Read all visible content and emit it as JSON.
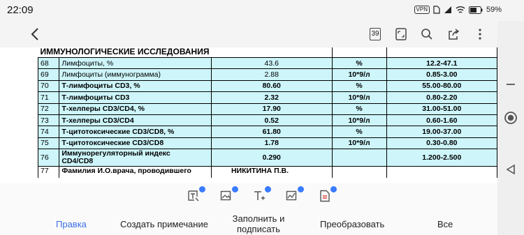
{
  "status_bar": {
    "time": "22:09",
    "vpn": "VPN",
    "battery": "59%"
  },
  "app_bar": {
    "page_count": "39"
  },
  "document": {
    "section_title": "ИММУНОЛОГИЧЕСКИЕ ИССЛЕДОВАНИЯ",
    "rows": [
      {
        "num": "68",
        "name": "Лимфоциты, %",
        "value": "43.6",
        "unit": "%",
        "ref": "12.2-47.1",
        "bold": false
      },
      {
        "num": "69",
        "name": "Лимфоциты (иммунограмма)",
        "value": "2.88",
        "unit": "10*9/л",
        "ref": "0.85-3.00",
        "bold": false
      },
      {
        "num": "70",
        "name": "Т-лимфоциты CD3, %",
        "value": "80.60",
        "unit": "%",
        "ref": "55.00-80.00",
        "bold": true
      },
      {
        "num": "71",
        "name": "Т-лимфоциты CD3",
        "value": "2.32",
        "unit": "10*9/л",
        "ref": "0.80-2.20",
        "bold": true
      },
      {
        "num": "72",
        "name": "Т-хелперы CD3/CD4, %",
        "value": "17.90",
        "unit": "%",
        "ref": "31.00-51.00",
        "bold": true
      },
      {
        "num": "73",
        "name": "Т-хелперы CD3/CD4",
        "value": "0.52",
        "unit": "10*9/л",
        "ref": "0.60-1.60",
        "bold": true
      },
      {
        "num": "74",
        "name": "Т-цитотоксические CD3/CD8, %",
        "value": "61.80",
        "unit": "%",
        "ref": "19.00-37.00",
        "bold": true
      },
      {
        "num": "75",
        "name": "Т-цитотоксические CD3/CD8",
        "value": "1.78",
        "unit": "10*9/л",
        "ref": "0.30-0.80",
        "bold": true
      }
    ],
    "row_76": {
      "num": "76",
      "name_line1": "Иммунорегуляторный индекс",
      "name_line2": "CD4/CD8",
      "value": "0.290",
      "unit": "",
      "ref": "1.200-2.500"
    },
    "row_77": {
      "num": "77",
      "name": "Фамилия И.О.врача, проводившего",
      "value": "НИКИТИНА П.В."
    }
  },
  "edit_toolbar": {
    "tools": [
      "text-note-icon",
      "image-edit-icon",
      "text-insert-icon",
      "signature-chart-icon",
      "pdf-convert-icon"
    ]
  },
  "bottom_nav": {
    "edit": "Правка",
    "comment": "Создать примечание",
    "fill_sign_line1": "Заполнить и",
    "fill_sign_line2": "подписать",
    "convert": "Преобразовать",
    "all": "Все"
  },
  "colors": {
    "highlight": "#cdf5fa",
    "accent": "#3d6fe6",
    "badge": "#3a7bff"
  }
}
